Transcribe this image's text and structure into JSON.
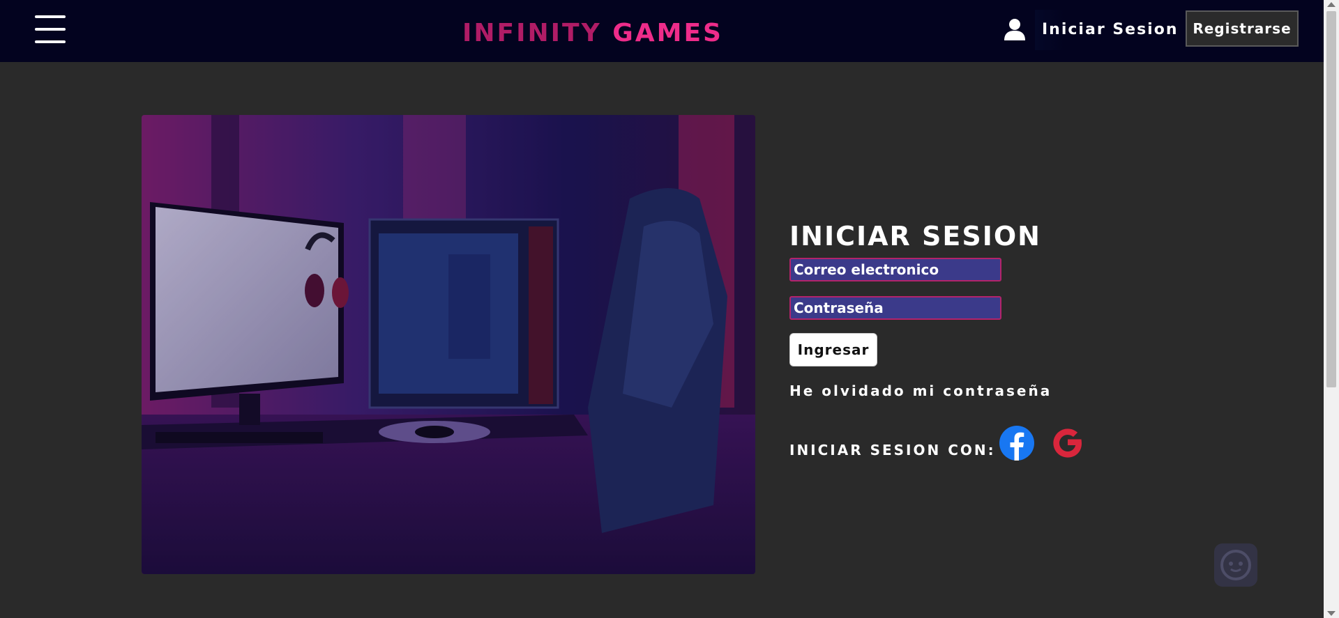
{
  "header": {
    "logo_part1": "INFINITY",
    "logo_part2": "GAMES",
    "login_label": "Iniciar Sesion",
    "register_label": "Registrarse"
  },
  "login": {
    "title": "INICIAR SESION",
    "email_placeholder": "Correo electronico",
    "password_placeholder": "Contraseña",
    "submit_label": "Ingresar",
    "forgot_label": "He olvidado mi contraseña",
    "social_label": "INICIAR SESION CON:"
  },
  "icons": {
    "menu": "hamburger-menu-icon",
    "user": "user-icon",
    "facebook": "facebook-icon",
    "google": "google-icon",
    "assistant": "bot-icon"
  },
  "colors": {
    "navbar": "#03031f",
    "background": "#2a2a2a",
    "logo_primary": "#b01c66",
    "logo_accent": "#ee2c8a",
    "input_bg": "#3b3a8a",
    "input_border": "#b3236b",
    "facebook": "#1877f2",
    "google": "#d9263c"
  }
}
